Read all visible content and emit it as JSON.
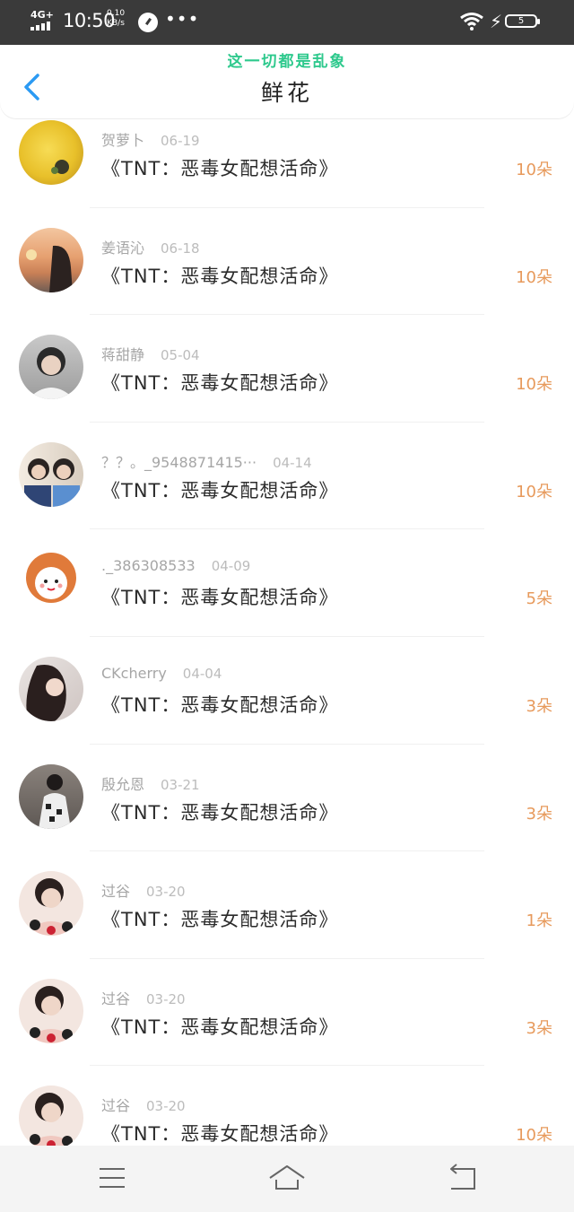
{
  "status_bar": {
    "network": "4G+",
    "time": "10:50",
    "speed_value": "0.10",
    "speed_unit": "KB/s",
    "more": "•••",
    "battery": "5"
  },
  "header": {
    "watermark": "这一切都是乱象",
    "title": "鲜花"
  },
  "items": [
    {
      "name": "贺萝卜",
      "date": "06-19",
      "book": "《TNT：恶毒女配想活命》",
      "count": "10朵",
      "avatar_color": "#e8c02a"
    },
    {
      "name": "姜语沁",
      "date": "06-18",
      "book": "《TNT：恶毒女配想活命》",
      "count": "10朵",
      "avatar_color": "#d99873"
    },
    {
      "name": "蒋甜静",
      "date": "05-04",
      "book": "《TNT：恶毒女配想活命》",
      "count": "10朵",
      "avatar_color": "#8e8e8e"
    },
    {
      "name": "？？。_9548871415···",
      "date": "04-14",
      "book": "《TNT：恶毒女配想活命》",
      "count": "10朵",
      "avatar_color": "#3f4f6e"
    },
    {
      "name": "._386308533",
      "date": "04-09",
      "book": "《TNT：恶毒女配想活命》",
      "count": "5朵",
      "avatar_color": "#e07a3a"
    },
    {
      "name": "CKcherry",
      "date": "04-04",
      "book": "《TNT：恶毒女配想活命》",
      "count": "3朵",
      "avatar_color": "#5a4a48"
    },
    {
      "name": "殷允恩",
      "date": "03-21",
      "book": "《TNT：恶毒女配想活命》",
      "count": "3朵",
      "avatar_color": "#6f6660"
    },
    {
      "name": "过谷",
      "date": "03-20",
      "book": "《TNT：恶毒女配想活命》",
      "count": "1朵",
      "avatar_color": "#4a3c36"
    },
    {
      "name": "过谷",
      "date": "03-20",
      "book": "《TNT：恶毒女配想活命》",
      "count": "3朵",
      "avatar_color": "#4a3c36"
    },
    {
      "name": "过谷",
      "date": "03-20",
      "book": "《TNT：恶毒女配想活命》",
      "count": "10朵",
      "avatar_color": "#4a3c36"
    }
  ],
  "icons": {
    "back": "chevron-left-icon",
    "menu": "menu-icon",
    "home": "home-icon",
    "return": "return-icon"
  },
  "colors": {
    "accent": "#2b9af3",
    "watermark": "#2ec98d",
    "count": "#e79a5c"
  }
}
